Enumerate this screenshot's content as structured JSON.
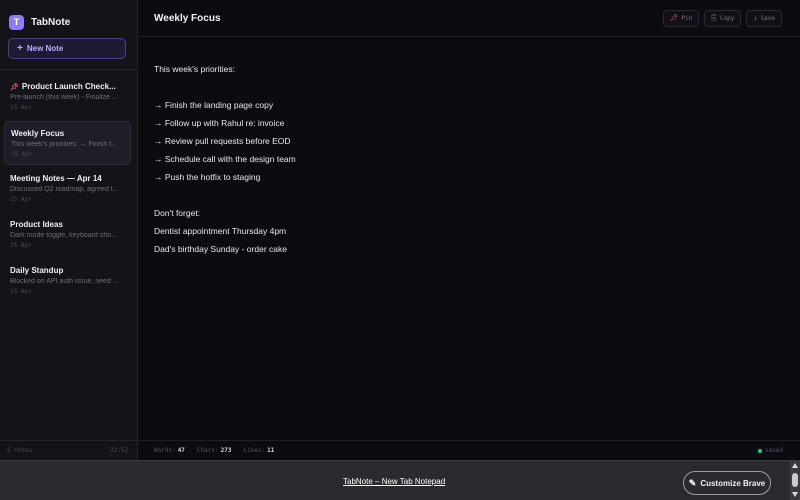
{
  "brand": {
    "logo_letter": "T",
    "name": "TabNote"
  },
  "sidebar": {
    "new_note_icon": "+",
    "new_note_label": "New Note",
    "notes": [
      {
        "title": "Product Launch Check...",
        "preview": "Pre-launch (this week) - Finalize ...",
        "date": "15 Apr",
        "pinned": true
      },
      {
        "title": "Weekly Focus",
        "preview": "This week's priorities: → Finish t...",
        "date": "15 Apr",
        "active": true
      },
      {
        "title": "Meeting Notes — Apr 14",
        "preview": "Discussed Q2 roadmap, agreed t...",
        "date": "15 Apr"
      },
      {
        "title": "Product Ideas",
        "preview": "Dark mode toggle, keyboard sho...",
        "date": "15 Apr"
      },
      {
        "title": "Daily Standup",
        "preview": "Blocked on API auth issue, need ...",
        "date": "15 Apr"
      }
    ],
    "footer_count": "5 notes",
    "footer_time": "22:52"
  },
  "main": {
    "title": "Weekly Focus",
    "actions": {
      "pin_label": "Pin",
      "copy_label": "Copy",
      "save_label": "Save"
    },
    "lines": [
      "This week's priorities:",
      "",
      "→ Finish the landing page copy",
      "→ Follow up with Rahul re: invoice",
      "→ Review pull requests before EOD",
      "→ Schedule call with the design team",
      "→ Push the hotfix to staging",
      "",
      "Don't forget:",
      "Dentist appointment Thursday 4pm",
      "Dad's birthday Sunday - order cake"
    ],
    "status": {
      "words_label": "Words:",
      "words": "47",
      "chars_label": "Chars:",
      "chars": "273",
      "lines_label": "Lines:",
      "lines": "11",
      "saved_label": "saved"
    }
  },
  "bravebar": {
    "link_text": "TabNote – New Tab Notepad",
    "customize_label": "Customize Brave"
  },
  "icons": {
    "pin": "pin-icon",
    "copy": "copy-icon",
    "save": "save-icon",
    "pencil": "pencil-icon"
  },
  "colors": {
    "accent": "#8f7df5",
    "pin": "#e0557a",
    "saved_dot": "#36c28a",
    "background": "#0c0b10"
  }
}
